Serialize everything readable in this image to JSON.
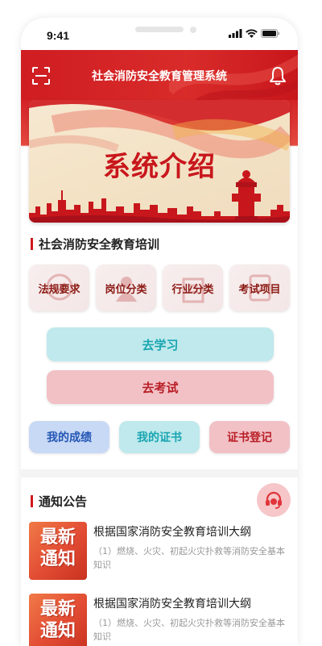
{
  "status_bar": {
    "time": "9:41"
  },
  "header": {
    "title": "社会消防安全教育管理系统",
    "scan_icon": "scan-icon",
    "bell_icon": "bell-icon"
  },
  "banner": {
    "title": "系统介绍"
  },
  "training": {
    "title": "社会消防安全教育培训",
    "categories": [
      {
        "label": "法规要求"
      },
      {
        "label": "岗位分类"
      },
      {
        "label": "行业分类"
      },
      {
        "label": "考试项目"
      }
    ],
    "study_label": "去学习",
    "exam_label": "去考试",
    "quick_links": [
      {
        "label": "我的成绩"
      },
      {
        "label": "我的证书"
      },
      {
        "label": "证书登记"
      }
    ]
  },
  "notices": {
    "title": "通知公告",
    "thumb_text": "最新\n通知",
    "items": [
      {
        "title": "根据国家消防安全教育培训大纲",
        "summary": "（1）燃烧、火灾、初起火灾扑救等消防安全基本知识",
        "thumb": "最新通知"
      },
      {
        "title": "根据国家消防安全教育培训大纲",
        "summary": "（1）燃烧、火灾、初起火灾扑救等消防安全基本知识",
        "thumb": "最新通知"
      }
    ]
  },
  "colors": {
    "brand_red": "#cf1d22",
    "teal": "#18a5b1",
    "blue": "#2356b5"
  }
}
